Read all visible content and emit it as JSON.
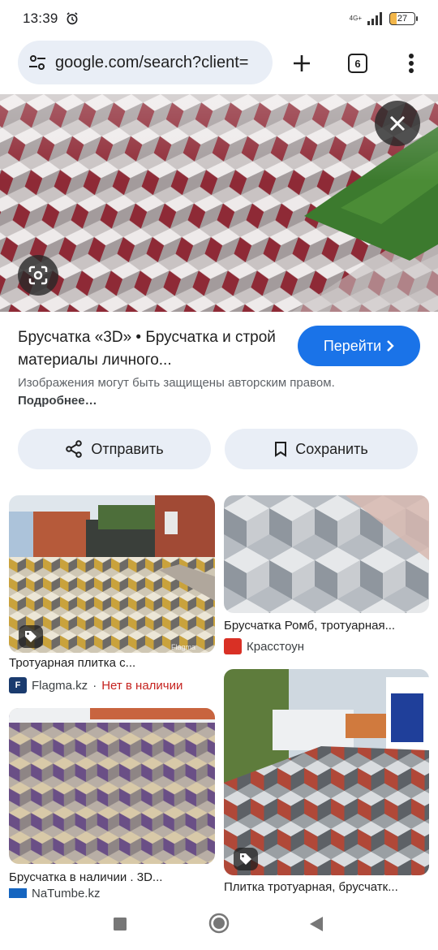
{
  "status_bar": {
    "time": "13:39",
    "network": "4G+",
    "battery": "27",
    "alarm_icon": "alarm-icon"
  },
  "browser": {
    "url": "google.com/search?client=",
    "tab_count": "6"
  },
  "result": {
    "title": "Брусчатка «3D» • Брусчатка и строй материалы личного...",
    "visit_label": "Перейти",
    "disclaimer": "Изображения могут быть защищены авторским правом.",
    "learn_more": "Подробнее…",
    "share_label": "Отправить",
    "save_label": "Сохранить"
  },
  "related": [
    {
      "caption": "Тротуарная плитка с...",
      "source": "Flagma.kz",
      "availability": "Нет в наличии",
      "watermark": "Flagma"
    },
    {
      "caption": "Брусчатка Ромб, тротуарная...",
      "source": "Красстоун"
    },
    {
      "caption": "Брусчатка в наличии . 3D...",
      "source": "NaTumbe.kz"
    },
    {
      "caption": "Плитка тротуарная, брусчатк..."
    }
  ],
  "colors": {
    "accent": "#1a73e8",
    "chip_bg": "#e9eef6",
    "out_of_stock": "#c5221f"
  }
}
